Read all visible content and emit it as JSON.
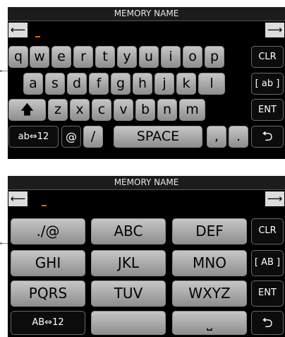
{
  "alpha_panel": {
    "title": "MEMORY NAME",
    "row1": [
      "q",
      "w",
      "e",
      "r",
      "t",
      "y",
      "u",
      "i",
      "o",
      "p"
    ],
    "row2": [
      "a",
      "s",
      "d",
      "f",
      "g",
      "h",
      "j",
      "k",
      "l"
    ],
    "row3": [
      "z",
      "x",
      "c",
      "v",
      "b",
      "n",
      "m"
    ],
    "mode_key": "ab⇔12",
    "at_key": "@",
    "slash_key": "/",
    "space_key": "SPACE",
    "comma_key": ",",
    "period_key": ".",
    "side_keys": {
      "clr": "CLR",
      "case": "[ ab ]",
      "ent": "ENT"
    },
    "glyphs": {
      "left": "⟵",
      "right": "⟶",
      "shift": "🡅",
      "back": "⮌"
    }
  },
  "tenkey_panel": {
    "title": "MEMORY NAME",
    "rows": [
      [
        "./@",
        "ABC",
        "DEF"
      ],
      [
        "GHI",
        "JKL",
        "MNO"
      ],
      [
        "PQRS",
        "TUV",
        "WXYZ"
      ]
    ],
    "mode_key": "AB⇔12",
    "side_keys": {
      "clr": "CLR",
      "case": "[ AB ]",
      "ent": "ENT"
    },
    "glyphs": {
      "left": "⟵",
      "right": "⟶",
      "space": "⎵",
      "back": "⮌"
    }
  },
  "colors": {
    "cursor": "#e06a00",
    "background": "#000000",
    "key_face": "#b0b0b0"
  }
}
